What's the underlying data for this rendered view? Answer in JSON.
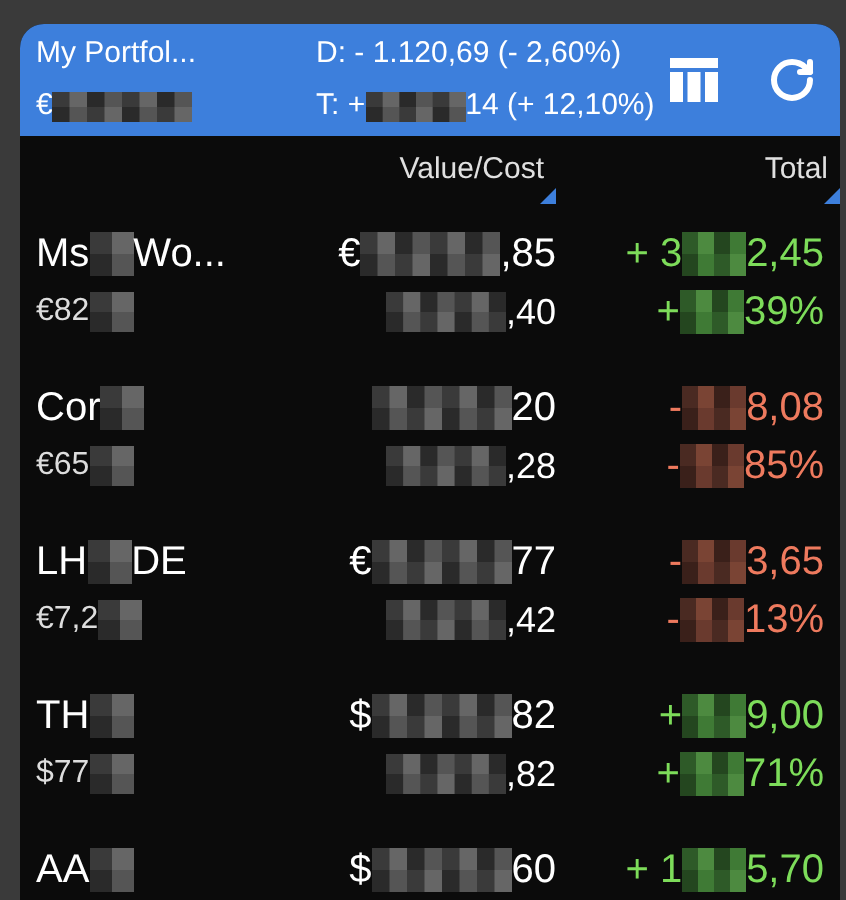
{
  "header": {
    "title": "My Portfol...",
    "balance": {
      "pre": "€"
    },
    "day_change": "D: - 1.120,69 (- 2,60%)",
    "total_change": {
      "pre": "T: +",
      "post": "14 (+ 12,10%)"
    }
  },
  "columns": [
    {
      "label": "Value/Cost"
    },
    {
      "label": "Total"
    }
  ],
  "rows": [
    {
      "kind": "gain",
      "name": {
        "pre": "Ms",
        "post": "Wo..."
      },
      "price": {
        "pre": "€82"
      },
      "value": {
        "pre": "€",
        "post": ",85"
      },
      "cost": {
        "post": ",40"
      },
      "total": {
        "pre": "+ 3",
        "post": "2,45"
      },
      "percent": {
        "pre": "+",
        "post": "39%"
      }
    },
    {
      "kind": "loss",
      "name": {
        "pre": "Cor"
      },
      "price": {
        "pre": "€65"
      },
      "value": {
        "post": "20"
      },
      "cost": {
        "post": ",28"
      },
      "total": {
        "pre": "-",
        "post": "8,08"
      },
      "percent": {
        "pre": "-",
        "post": "85%"
      }
    },
    {
      "kind": "loss",
      "name": {
        "pre": "LH",
        "post": "DE"
      },
      "price": {
        "pre": "€7,2"
      },
      "value": {
        "pre": "€",
        "post": "77"
      },
      "cost": {
        "post": ",42"
      },
      "total": {
        "pre": "-",
        "post": "3,65"
      },
      "percent": {
        "pre": "-",
        "post": "13%"
      }
    },
    {
      "kind": "gain",
      "name": {
        "pre": "TH"
      },
      "price": {
        "pre": "$77"
      },
      "value": {
        "pre": "$",
        "post": "82"
      },
      "cost": {
        "post": ",82"
      },
      "total": {
        "pre": "+",
        "post": "9,00"
      },
      "percent": {
        "pre": "+",
        "post": "71%"
      }
    },
    {
      "kind": "gain",
      "name": {
        "pre": "AA"
      },
      "value": {
        "pre": "$",
        "post": "60"
      },
      "total": {
        "pre": "+ 1",
        "post": "5,70"
      }
    }
  ]
}
